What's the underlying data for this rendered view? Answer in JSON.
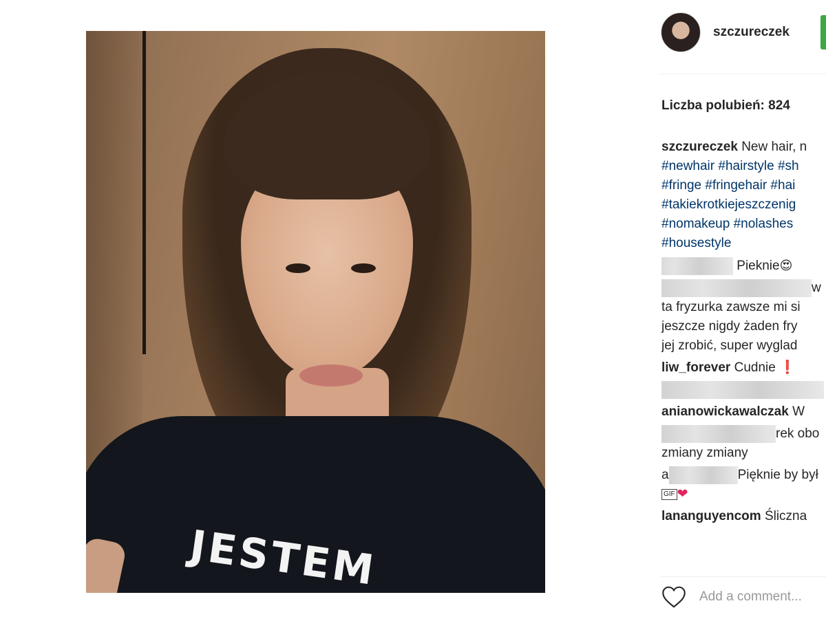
{
  "post": {
    "username": "szczureczek",
    "likes_text": "Liczba polubień: 824",
    "shirt_text": "JESTEM"
  },
  "comments": [
    {
      "user": "szczureczek",
      "lines": [
        "New hair, n",
        "#newhair #hairstyle #sh",
        "#fringe #fringehair #hai",
        "#takiekrotkiejeszczenig",
        "#nomakeup #nolashes",
        "#housestyle"
      ]
    },
    {
      "text": "Pieknie",
      "emoji": "😍"
    },
    {
      "lines": [
        "w",
        "ta fryzurka zawsze mi si",
        "jeszcze nigdy żaden fry",
        "jej zrobić, super wyglad"
      ]
    },
    {
      "user": "liw_forever",
      "text": "Cudnie",
      "emoji": "❗"
    },
    {
      "user": "anianowickawalczak",
      "text": "W"
    },
    {
      "lines": [
        "rek obo",
        "zmiany zmiany"
      ]
    },
    {
      "prefix": "a",
      "text": "Pięknie by był",
      "gif_label": "GIF"
    },
    {
      "user": "lananguyencom",
      "text": "Śliczna"
    }
  ],
  "actions": {
    "comment_placeholder": "Add a comment..."
  },
  "icons": {
    "like": "heart-outline-icon",
    "heart_emoji": "heart-icon",
    "gif": "gif-icon"
  },
  "colors": {
    "hashtag": "#003569",
    "follow_button": "#3ea843",
    "placeholder": "#999999"
  }
}
